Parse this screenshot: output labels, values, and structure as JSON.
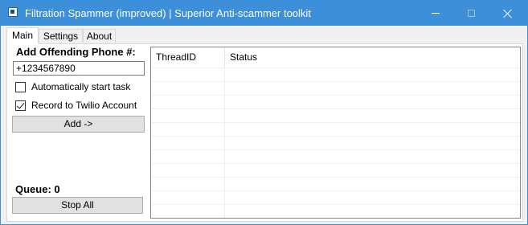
{
  "window": {
    "title": "Filtration Spammer (improved) | Superior Anti-scammer toolkit"
  },
  "tabs": [
    {
      "label": "Main",
      "active": true
    },
    {
      "label": "Settings",
      "active": false
    },
    {
      "label": "About",
      "active": false
    }
  ],
  "main": {
    "phone_label": "Add Offending Phone #:",
    "phone_value": "+1234567890",
    "auto_start_label": "Automatically start task",
    "auto_start_checked": false,
    "record_label": "Record to Twilio Account",
    "record_checked": true,
    "add_button": "Add ->",
    "queue_label": "Queue: 0",
    "stop_button": "Stop All"
  },
  "thread_list": {
    "columns": [
      "ThreadID",
      "Status"
    ],
    "rows": []
  },
  "colors": {
    "titlebar": "#3c8fd8",
    "window_bg": "#f0f0f0",
    "button_bg": "#e1e1e1"
  }
}
